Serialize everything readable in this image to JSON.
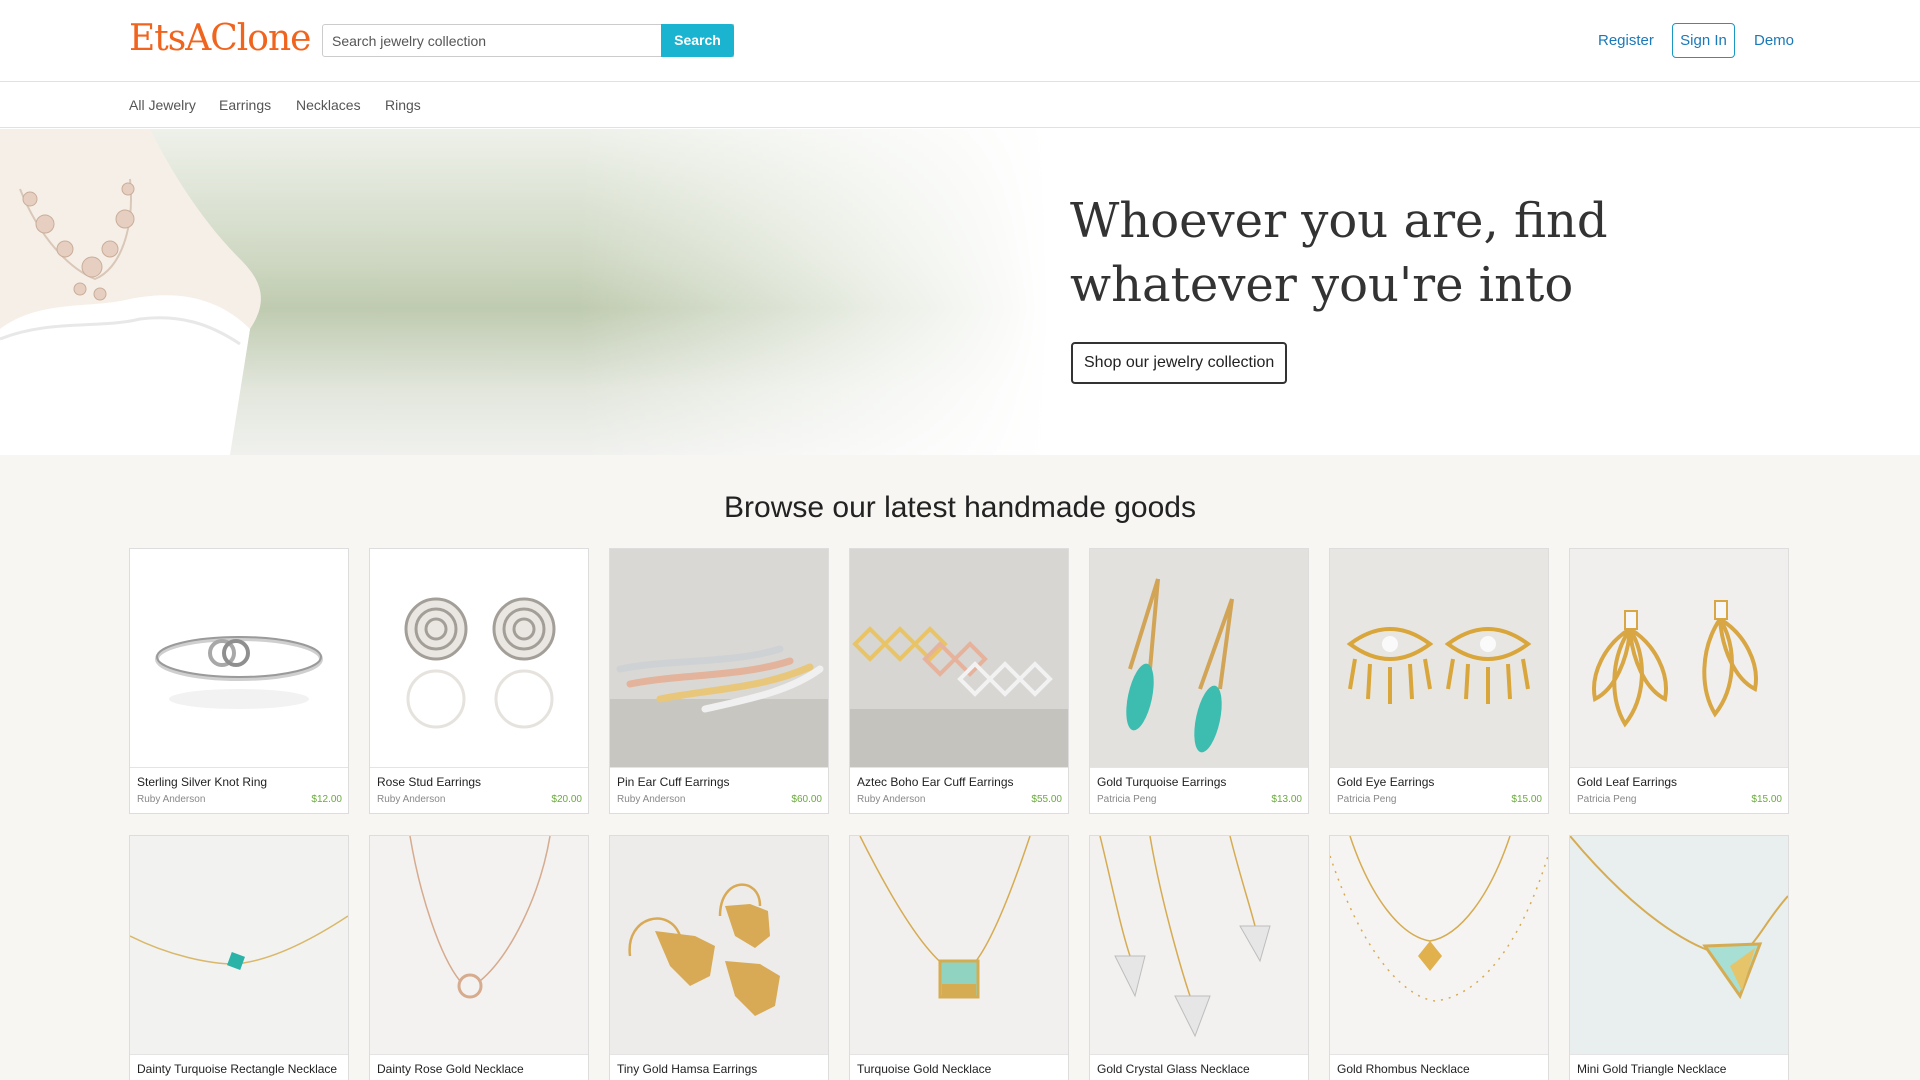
{
  "header": {
    "logo": "EtsAClone",
    "search_placeholder": "Search jewelry collection",
    "search_button": "Search",
    "register": "Register",
    "sign_in": "Sign In",
    "demo": "Demo"
  },
  "categories": [
    "All Jewelry",
    "Earrings",
    "Necklaces",
    "Rings"
  ],
  "hero": {
    "title_line1": "Whoever you are, find",
    "title_line2": "whatever you're into",
    "button": "Shop our jewelry collection"
  },
  "browse": {
    "title": "Browse our latest handmade goods",
    "row1": [
      {
        "title": "Sterling Silver Knot Ring",
        "seller": "Ruby Anderson",
        "price": "$12.00",
        "icon": "knot-ring"
      },
      {
        "title": "Rose Stud Earrings",
        "seller": "Ruby Anderson",
        "price": "$20.00",
        "icon": "rose-studs"
      },
      {
        "title": "Pin Ear Cuff Earrings",
        "seller": "Ruby Anderson",
        "price": "$60.00",
        "icon": "ear-cuffs"
      },
      {
        "title": "Aztec Boho Ear Cuff Earrings",
        "seller": "Ruby Anderson",
        "price": "$55.00",
        "icon": "aztec-cuffs"
      },
      {
        "title": "Gold Turquoise Earrings",
        "seller": "Patricia Peng",
        "price": "$13.00",
        "icon": "turquoise-drops"
      },
      {
        "title": "Gold Eye Earrings",
        "seller": "Patricia Peng",
        "price": "$15.00",
        "icon": "eye-earrings"
      },
      {
        "title": "Gold Leaf Earrings",
        "seller": "Patricia Peng",
        "price": "$15.00",
        "icon": "leaf-earrings"
      }
    ],
    "row2": [
      {
        "title": "Dainty Turquoise Rectangle Necklace",
        "icon": "turquoise-necklace"
      },
      {
        "title": "Dainty Rose Gold Necklace",
        "icon": "circle-necklace"
      },
      {
        "title": "Tiny Gold Hamsa Earrings",
        "icon": "hamsa-earrings"
      },
      {
        "title": "Turquoise Gold Necklace",
        "icon": "square-necklace"
      },
      {
        "title": "Gold Crystal Glass Necklace",
        "icon": "crystal-necklace"
      },
      {
        "title": "Gold Rhombus Necklace",
        "icon": "rhombus-necklace"
      },
      {
        "title": "Mini Gold Triangle Necklace",
        "icon": "triangle-necklace"
      }
    ]
  },
  "colors": {
    "brand": "#f1641e",
    "accent": "#1ab3d0",
    "link": "#1a79b8",
    "price": "#6aa93b",
    "section_bg": "#f7f6f2"
  }
}
